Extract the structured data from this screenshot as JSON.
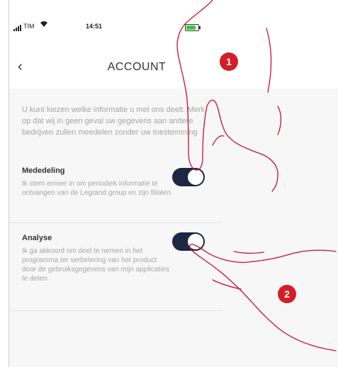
{
  "status_bar": {
    "carrier": "TIM",
    "time": "14:51"
  },
  "nav": {
    "back_icon": "‹",
    "title": "ACCOUNT"
  },
  "intro_text": "U kunt kiezen welke informatie u met ons deelt. Merk op dat wij in geen geval uw gegevens aan andere bedrijven zullen meedelen zonder uw toestemming",
  "settings": [
    {
      "label": "Mededeling",
      "description": "Ik stem ermee in om periodiek informatie te ontvangen van de Legrand group en zijn filialen",
      "enabled": true
    },
    {
      "label": "Analyse",
      "description": "Ik ga akkoord om deel te nemen in het programma ter verbetering van het product door de gebruiksgegevens van mijn applicaties te delen",
      "enabled": true
    }
  ],
  "callouts": [
    {
      "number": "1",
      "target": "Mededeling toggle"
    },
    {
      "number": "2",
      "target": "Analyse toggle"
    }
  ],
  "colors": {
    "toggle_on": "#1c2741",
    "callout_red": "#d21f27",
    "hand_outline": "#c8102e"
  }
}
